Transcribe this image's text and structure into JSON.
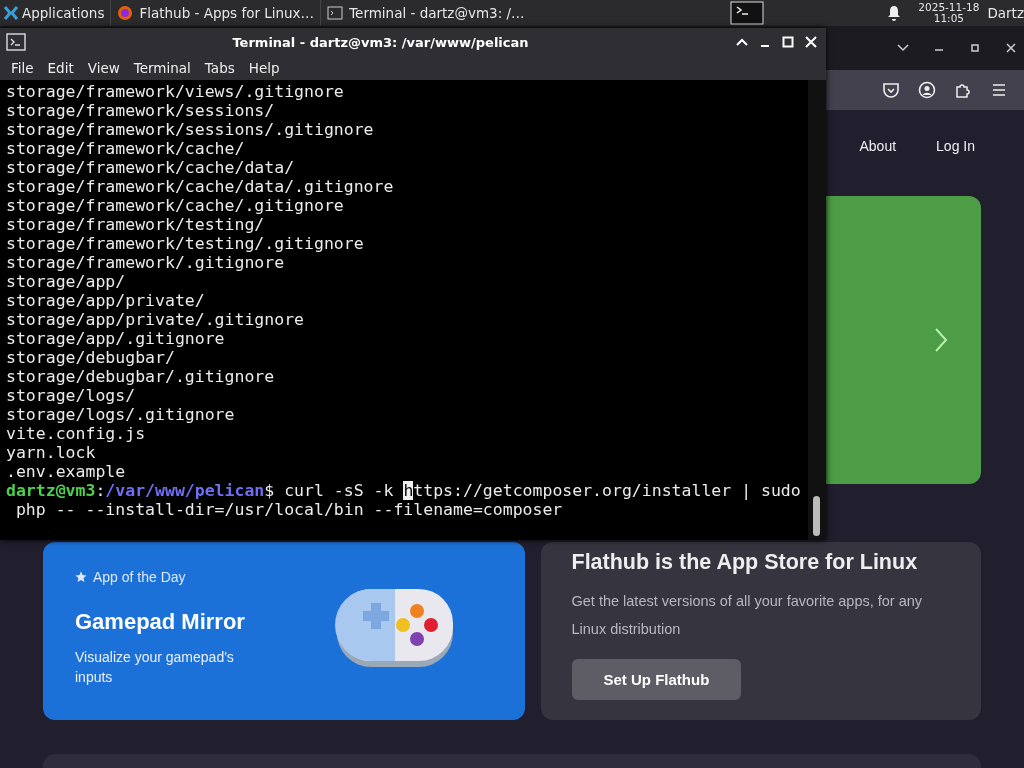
{
  "taskbar": {
    "apps_menu": "Applications",
    "tasks": [
      {
        "title": "Flathub - Apps for Linux…"
      },
      {
        "title": "Terminal - dartz@vm3: /…"
      }
    ],
    "date": "2025-11-18",
    "time": "11:05",
    "user": "Dartz"
  },
  "terminal": {
    "title": "Terminal - dartz@vm3: /var/www/pelican",
    "menu": [
      "File",
      "Edit",
      "View",
      "Terminal",
      "Tabs",
      "Help"
    ],
    "lines": [
      "storage/framework/views/.gitignore",
      "storage/framework/sessions/",
      "storage/framework/sessions/.gitignore",
      "storage/framework/cache/",
      "storage/framework/cache/data/",
      "storage/framework/cache/data/.gitignore",
      "storage/framework/cache/.gitignore",
      "storage/framework/testing/",
      "storage/framework/testing/.gitignore",
      "storage/framework/.gitignore",
      "storage/app/",
      "storage/app/private/",
      "storage/app/private/.gitignore",
      "storage/app/.gitignore",
      "storage/debugbar/",
      "storage/debugbar/.gitignore",
      "storage/logs/",
      "storage/logs/.gitignore",
      "vite.config.js",
      "yarn.lock",
      ".env.example"
    ],
    "prompt": {
      "user_host": "dartz@vm3",
      "separator": ":",
      "path": "/var/www/pelican",
      "before_cursor": "$ curl -sS -k ",
      "cursor_char": "h",
      "after_cursor": "ttps://getcomposer.org/installer | sudo"
    },
    "continuation": " php -- --install-dir=/usr/local/bin --filename=composer"
  },
  "browser": {
    "nav": [
      "About",
      "Log In"
    ],
    "cards": [
      {
        "kind": "app_of_day",
        "badge": "App of the Day",
        "title": "Gamepad Mirror",
        "description": "Visualize your gamepad's inputs"
      },
      {
        "kind": "promo",
        "title": "Flathub is the App Store for Linux",
        "description": "Get the latest versions of all your favorite apps, for any Linux distribution",
        "button": "Set Up Flathub"
      }
    ]
  }
}
